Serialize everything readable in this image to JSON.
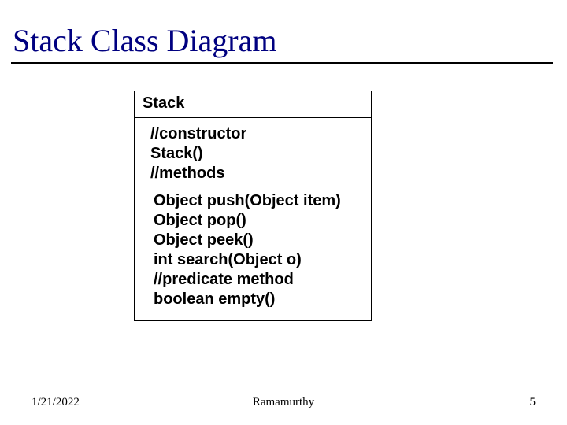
{
  "title": "Stack Class Diagram",
  "uml": {
    "class_name": "Stack",
    "section1": [
      "//constructor",
      "Stack()",
      "//methods"
    ],
    "section2": [
      "Object push(Object item)",
      "Object pop()",
      "Object peek()",
      "int search(Object o)",
      "//predicate method",
      "boolean empty()"
    ]
  },
  "footer": {
    "date": "1/21/2022",
    "author": "Ramamurthy",
    "page": "5"
  }
}
